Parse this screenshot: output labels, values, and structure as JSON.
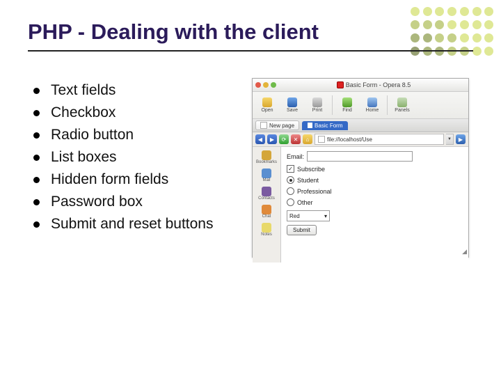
{
  "title": "PHP - Dealing with the client",
  "bullets": [
    "Text fields",
    "Checkbox",
    "Radio button",
    "List boxes",
    "Hidden form fields",
    "Password box",
    "Submit and reset buttons"
  ],
  "deco_colors": [
    "#c9d94f",
    "#c9d94f",
    "#c9d94f",
    "#c9d94f",
    "#c9d94f",
    "#c9d94f",
    "#c9d94f",
    "#9fb038",
    "#9fb038",
    "#9fb038",
    "#c9d94f",
    "#c9d94f",
    "#c9d94f",
    "#c9d94f",
    "#748727",
    "#748727",
    "#9fb038",
    "#9fb038",
    "#c9d94f",
    "#c9d94f",
    "#c9d94f",
    "#546318",
    "#748727",
    "#748727",
    "#9fb038",
    "#9fb038",
    "#c9d94f",
    "#c9d94f"
  ],
  "mockup": {
    "window_title": "Basic Form - Opera 8.5",
    "toolbar": {
      "open": "Open",
      "save": "Save",
      "print": "Print",
      "find": "Find",
      "home": "Home",
      "panels": "Panels"
    },
    "newpage": "New page",
    "tab_label": "Basic Form",
    "address": "file://localhost/Use",
    "sidebar": {
      "bookmarks": "Bookmarks",
      "mail": "Mail",
      "contacts": "Contacts",
      "chat": "Chat",
      "notes": "Notes"
    },
    "form": {
      "email_label": "Email:",
      "subscribe_label": "Subscribe",
      "subscribe_checked": true,
      "radios": [
        "Student",
        "Professional",
        "Other"
      ],
      "radio_selected": 0,
      "select_value": "Red",
      "submit_label": "Submit"
    }
  }
}
